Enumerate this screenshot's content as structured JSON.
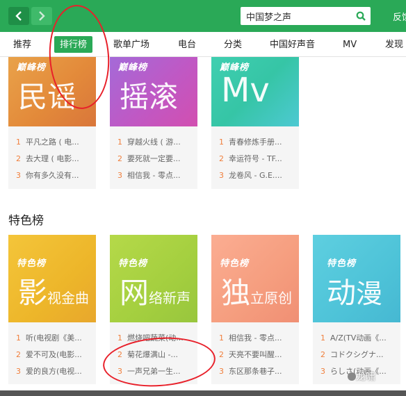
{
  "header": {
    "search_value": "中国梦之声",
    "feedback_label": "反馈"
  },
  "tabs": [
    "推荐",
    "排行榜",
    "歌单广场",
    "电台",
    "分类",
    "中国好声音",
    "MV",
    "发现"
  ],
  "top_cards": [
    {
      "logo": "巅峰榜",
      "title": "民谣",
      "tracks": [
        [
          "1",
          "平凡之路 ( 电..."
        ],
        [
          "2",
          "去大理 ( 电影..."
        ],
        [
          "3",
          "你有多久没有..."
        ]
      ]
    },
    {
      "logo": "巅峰榜",
      "title": "摇滚",
      "tracks": [
        [
          "1",
          "穿越火线 ( 游..."
        ],
        [
          "2",
          "要死就一定要..."
        ],
        [
          "3",
          "相信我 - 零点..."
        ]
      ]
    },
    {
      "logo": "巅峰榜",
      "title": "Mv",
      "tracks": [
        [
          "1",
          "青春修炼手册..."
        ],
        [
          "2",
          "幸运符号 - TF..."
        ],
        [
          "3",
          "龙卷风 - G.E...."
        ]
      ]
    }
  ],
  "special_section_title": "特色榜",
  "special_cards": [
    {
      "logo": "特色榜",
      "title_big": "影",
      "title_small": "视金曲",
      "tracks": [
        [
          "1",
          "听(电视剧《美..."
        ],
        [
          "2",
          "爱不可及(电影..."
        ],
        [
          "3",
          "爱的良方(电视..."
        ]
      ]
    },
    {
      "logo": "特色榜",
      "title_big": "网",
      "title_small": "络新声",
      "tracks": [
        [
          "1",
          "燃烧吧蔬菜(动..."
        ],
        [
          "2",
          "菊花爆满山 -..."
        ],
        [
          "3",
          "一声兄弟一生..."
        ]
      ]
    },
    {
      "logo": "特色榜",
      "title_big": "独",
      "title_small": "立原创",
      "tracks": [
        [
          "1",
          "相信我 - 零点..."
        ],
        [
          "2",
          "天亮不要叫醒..."
        ],
        [
          "3",
          "东区那条巷子..."
        ]
      ]
    },
    {
      "logo": "特色榜",
      "title_big": "动",
      "title_small": "漫",
      "tracks": [
        [
          "1",
          "A/Z(TV动画《..."
        ],
        [
          "2",
          "コドクシグナ..."
        ],
        [
          "3",
          "らしさ(动画《..."
        ]
      ]
    }
  ],
  "watermark": "龙啸",
  "colors": {
    "header_green": "#2aa957",
    "track_number": "#f07e3b",
    "annotation_red": "#e8202a"
  }
}
